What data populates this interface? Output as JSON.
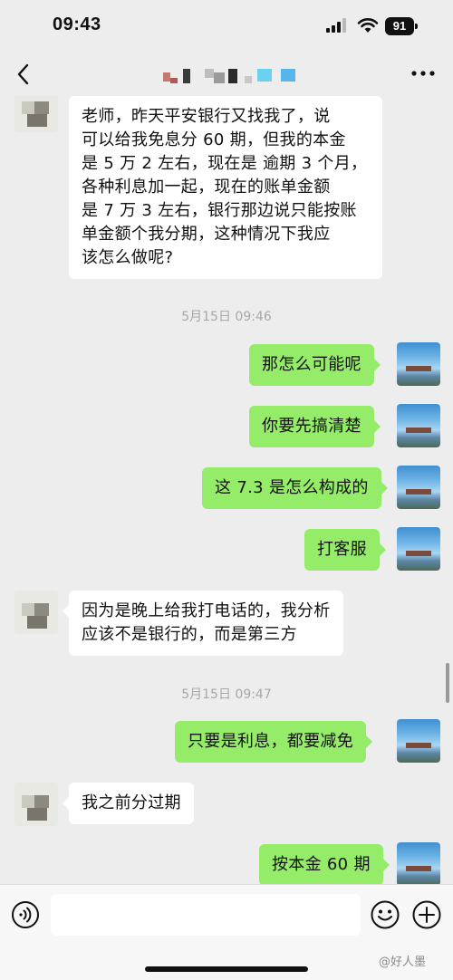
{
  "status_bar": {
    "time": "09:43",
    "battery": "91",
    "icons": [
      "signal-icon",
      "wifi-icon",
      "battery-icon"
    ]
  },
  "nav": {
    "back_icon": "chevron-left-icon",
    "more_icon": "ellipsis-icon"
  },
  "messages": [
    {
      "side": "left",
      "text": "老师，昨天平安银行又找我了，说\n可以给我免息分 60 期，但我的本金\n是 5 万 2 左右，现在是 逾期 3 个月，\n各种利息加一起，现在的账单金额\n是 7 万 3 左右，银行那边说只能按账\n单金额个我分期，这种情况下我应\n该怎么做呢?"
    },
    {
      "side": "right",
      "text": "那怎么可能呢"
    },
    {
      "side": "right",
      "text": "你要先搞清楚"
    },
    {
      "side": "right",
      "text": "这 7.3 是怎么构成的"
    },
    {
      "side": "right",
      "text": "打客服"
    },
    {
      "side": "left",
      "text": "因为是晚上给我打电话的，我分析\n应该不是银行的，而是第三方"
    },
    {
      "side": "right",
      "text": "只要是利息，都要减免"
    },
    {
      "side": "left",
      "text": "我之前分过期"
    },
    {
      "side": "right",
      "text": "按本金 60 期"
    }
  ],
  "timestamps": [
    "5月15日 09:46",
    "5月15日 09:47"
  ],
  "input_bar": {
    "placeholder": "",
    "icons": [
      "voice-icon",
      "emoji-icon",
      "plus-icon"
    ]
  },
  "watermark": "@好人墨",
  "colors": {
    "background": "#ededed",
    "outgoing_bubble": "#95ec69",
    "incoming_bubble": "#ffffff"
  }
}
